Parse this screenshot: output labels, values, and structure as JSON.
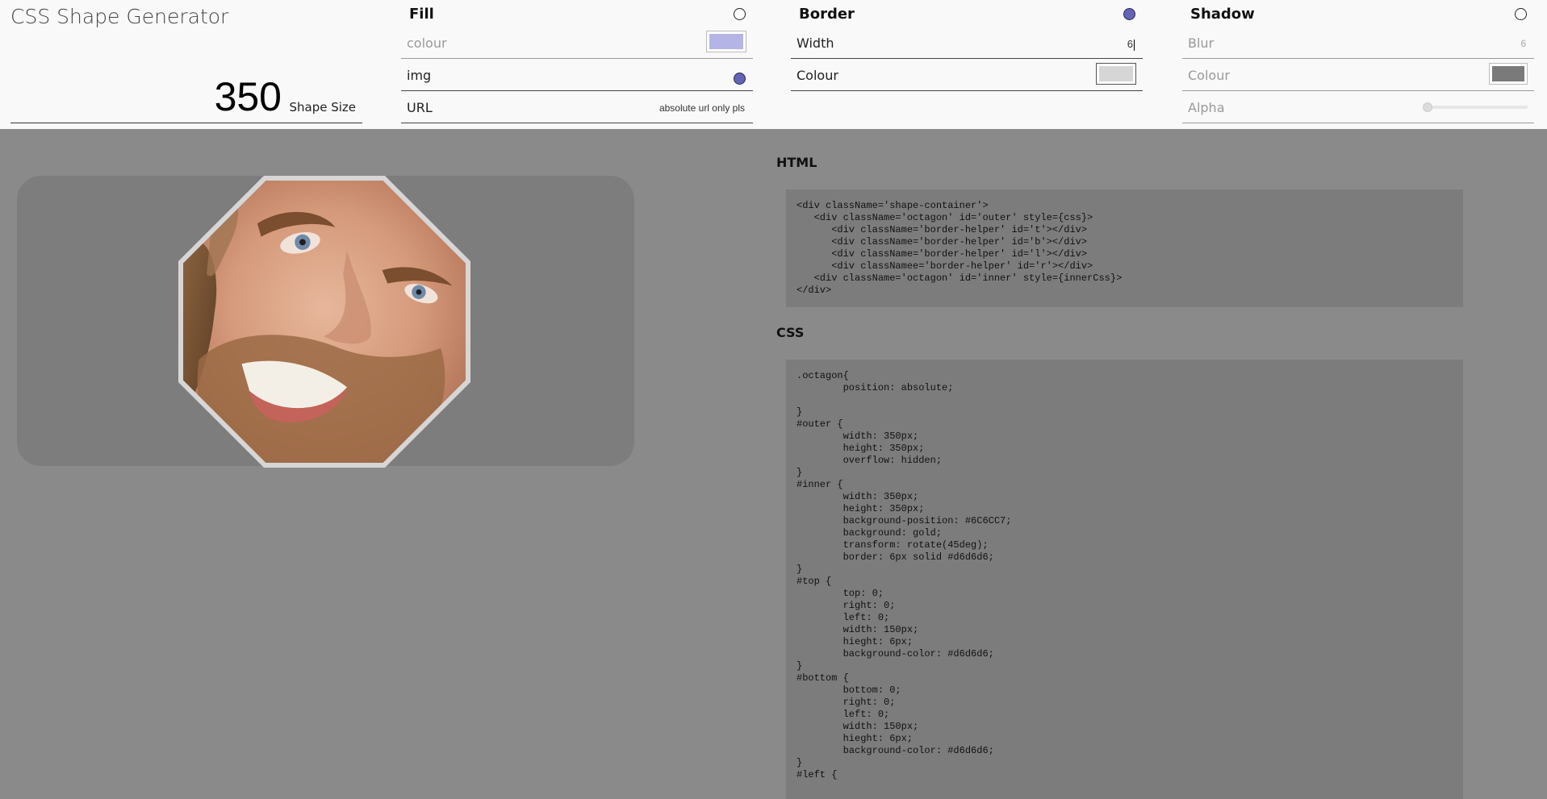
{
  "app": {
    "title": "CSS Shape Generator"
  },
  "shape_size": {
    "value": "350",
    "label": "Shape Size"
  },
  "fill": {
    "title": "Fill",
    "enabled": false,
    "colour_label": "colour",
    "colour_value": "#b4b4e6",
    "img_label": "img",
    "img_enabled": true,
    "url_label": "URL",
    "url_placeholder": "absolute url only pls"
  },
  "border": {
    "title": "Border",
    "enabled": true,
    "width_label": "Width",
    "width_value": "6",
    "colour_label": "Colour",
    "colour_value": "#d6d6d6"
  },
  "shadow": {
    "title": "Shadow",
    "enabled": false,
    "blur_label": "Blur",
    "blur_value": "6",
    "colour_label": "Colour",
    "colour_value": "#7a7a7a",
    "alpha_label": "Alpha",
    "alpha_value": 0
  },
  "html_section": {
    "title": "HTML",
    "code": "<div className='shape-container'>\n   <div className='octagon' id='outer' style={css}>\n      <div className='border-helper' id='t'></div>\n      <div className='border-helper' id='b'></div>\n      <div className='border-helper' id='l'></div>\n      <div classNamee='border-helper' id='r'></div>\n   <div className='octagon' id='inner' style={innerCss}>\n</div>"
  },
  "css_section": {
    "title": "CSS",
    "code": ".octagon{\n\tposition: absolute;\n\n}\n#outer {\n\twidth: 350px;\n\theight: 350px;\n\toverflow: hidden;\n}\n#inner {\n\twidth: 350px;\n\theight: 350px;\n\tbackground-position: #6C6CC7;\n\tbackground: gold;\n\ttransform: rotate(45deg);\n\tborder: 6px solid #d6d6d6;\n}\n#top {\n\ttop: 0;\n\tright: 0;\n\tleft: 0;\n\twidth: 150px;\n\thieght: 6px;\n\tbackground-color: #d6d6d6;\n}\n#bottom {\n\tbottom: 0;\n\tright: 0;\n\tleft: 0;\n\twidth: 150px;\n\thieght: 6px;\n\tbackground-color: #d6d6d6;\n}\n#left {"
  }
}
